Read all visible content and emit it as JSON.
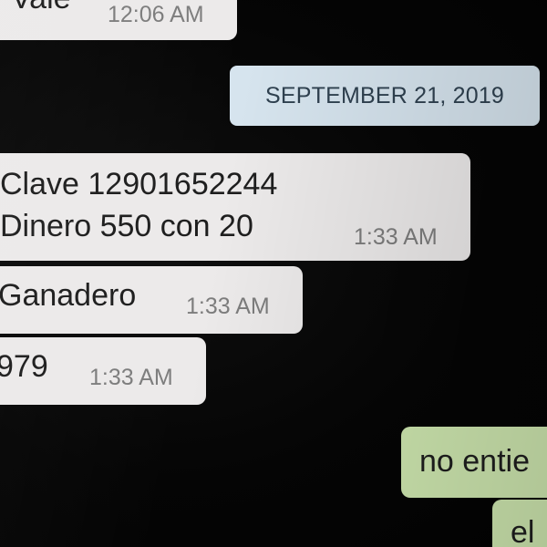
{
  "chat": {
    "date_separator": "SEPTEMBER 21, 2019",
    "messages": [
      {
        "direction": "incoming",
        "text": "Vale",
        "time": "12:06 AM"
      },
      {
        "direction": "incoming",
        "line1": "Clave 12901652244",
        "line2": "Dinero 550 con 20",
        "time": "1:33 AM"
      },
      {
        "direction": "incoming",
        "text": "Ganadero",
        "time": "1:33 AM"
      },
      {
        "direction": "incoming",
        "text": "979",
        "time": "1:33 AM"
      },
      {
        "direction": "outgoing",
        "text": "no entie"
      },
      {
        "direction": "outgoing",
        "text": "el"
      }
    ]
  },
  "colors": {
    "incoming_bubble": "#eceaea",
    "outgoing_bubble": "#cfe8b0",
    "date_pill": "#d6e4ee",
    "background": "#050505"
  }
}
